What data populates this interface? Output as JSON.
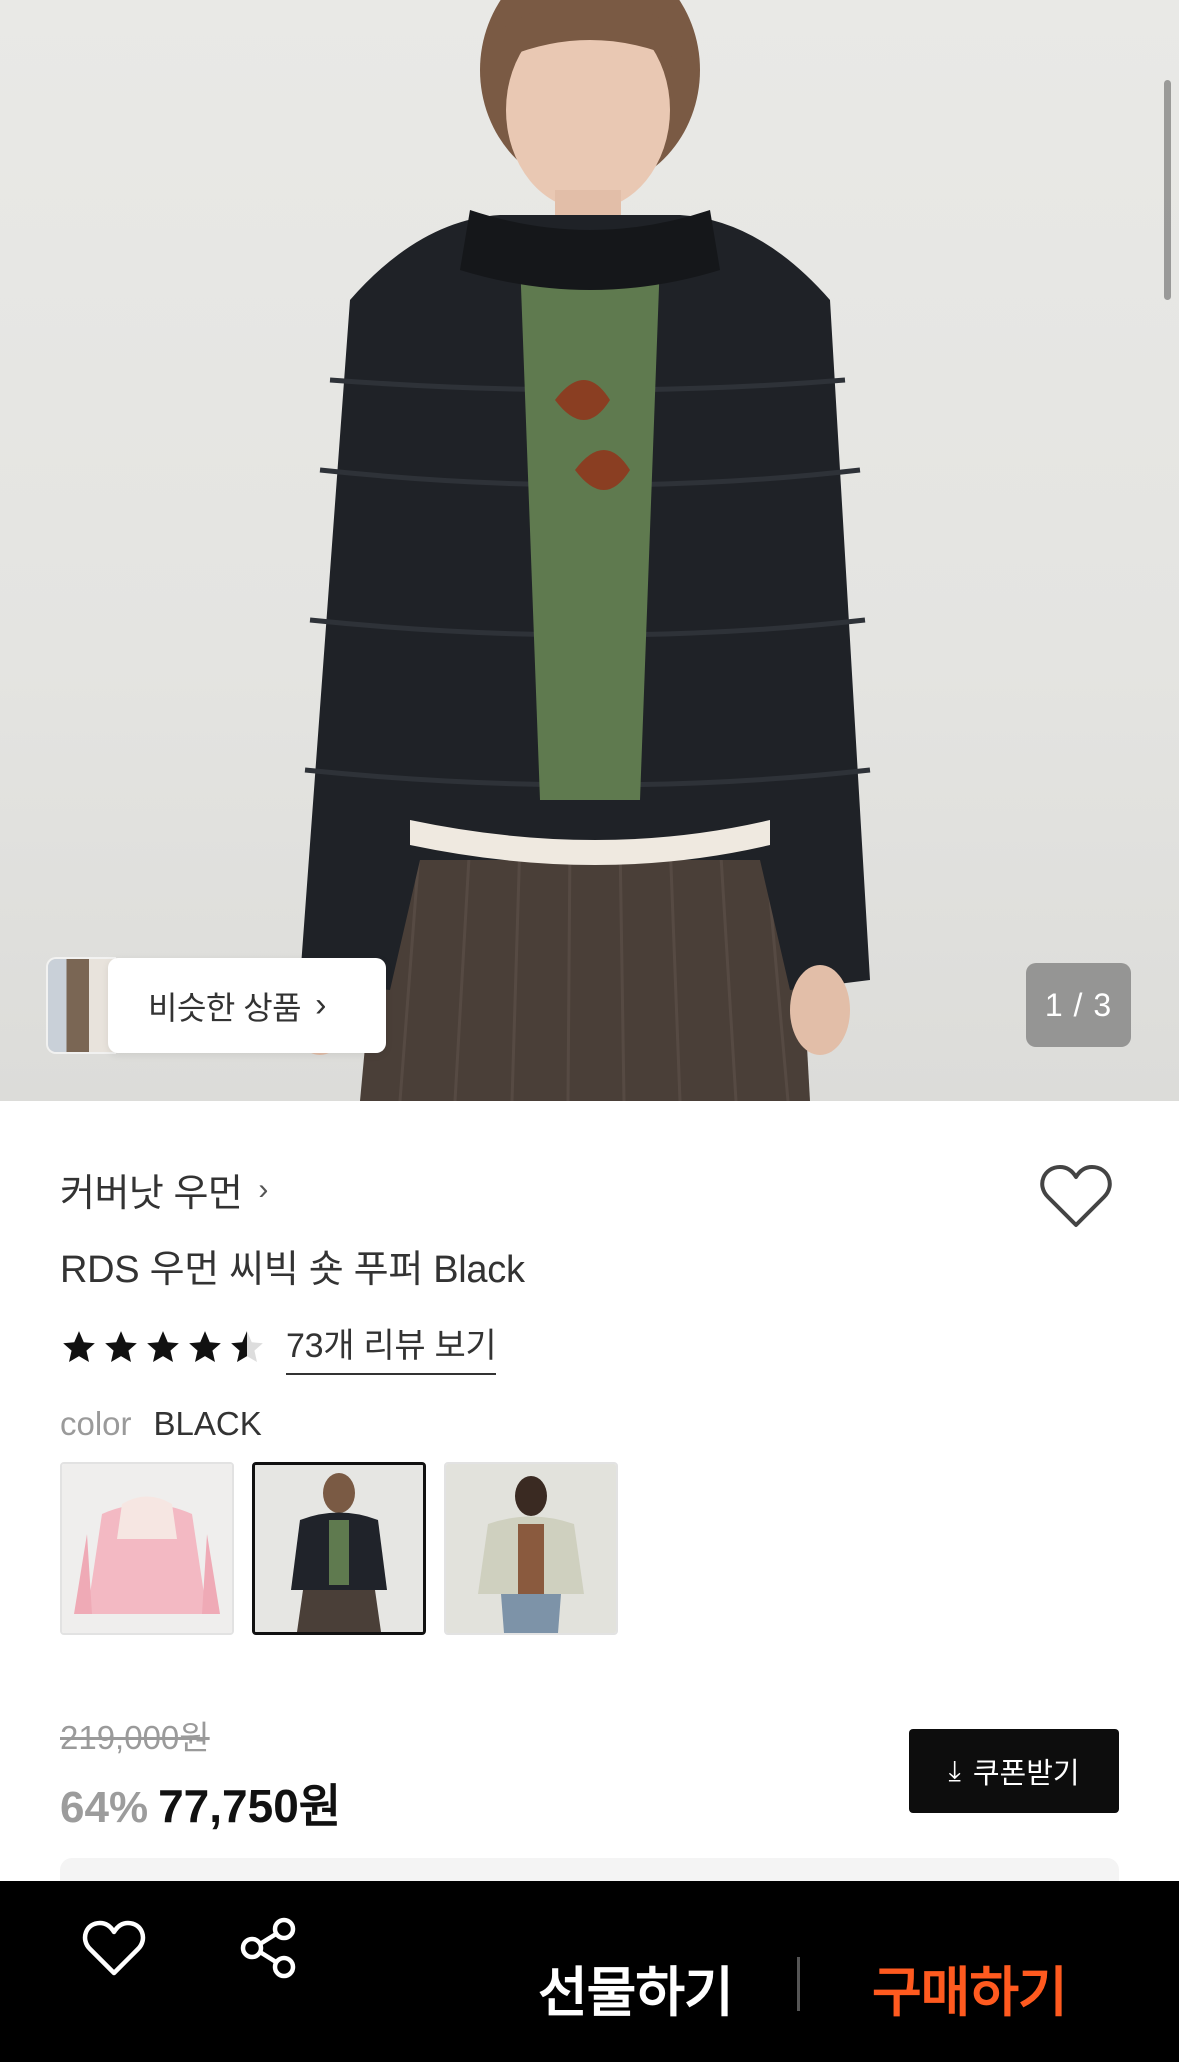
{
  "gallery": {
    "similar_label": "비슷한 상품",
    "counter": "1 / 3"
  },
  "product": {
    "brand": "커버낫 우먼",
    "title": "RDS 우먼 씨빅 숏 푸퍼 Black",
    "rating": 4.5,
    "review_link": "73개 리뷰 보기",
    "color_label": "color",
    "color_value": "BLACK",
    "color_options": [
      {
        "name": "pink",
        "selected": false
      },
      {
        "name": "black",
        "selected": true
      },
      {
        "name": "beige",
        "selected": false
      }
    ]
  },
  "pricing": {
    "original": "219,000원",
    "discount": "64%",
    "sale": "77,750원",
    "coupon_label": "쿠폰받기"
  },
  "bottom_bar": {
    "gift_label": "선물하기",
    "buy_label": "구매하기"
  },
  "colors": {
    "accent": "#ff5a1f",
    "bar_bg": "#000000",
    "coupon_bg": "#0d0d0d"
  }
}
